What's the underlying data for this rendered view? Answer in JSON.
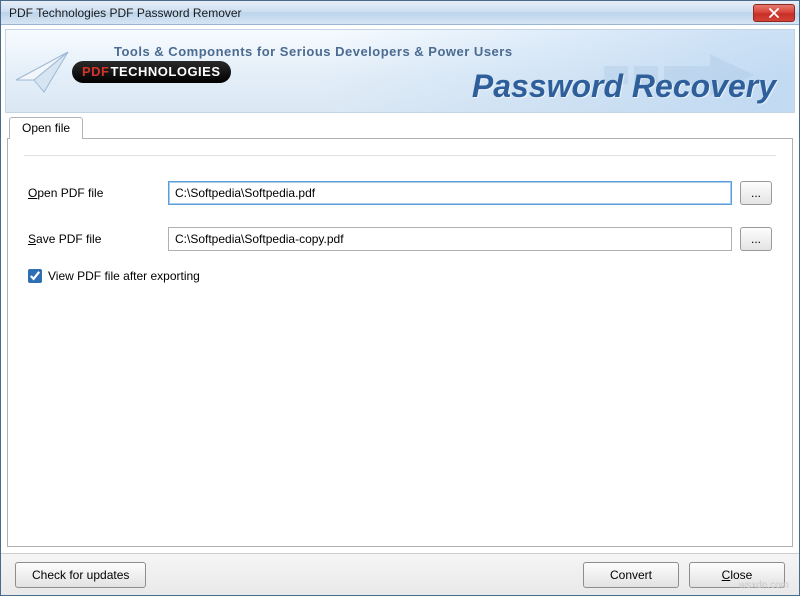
{
  "window": {
    "title": "PDF Technologies PDF Password Remover"
  },
  "banner": {
    "tagline": "Tools & Components for Serious Developers & Power Users",
    "product_title": "Password Recovery",
    "logo_pdf": "PDF",
    "logo_tech": "TECHNOLOGIES"
  },
  "tabs": {
    "open_file": "Open file"
  },
  "form": {
    "open_label_u": "O",
    "open_label_rest": "pen PDF file",
    "open_value": "C:\\Softpedia\\Softpedia.pdf",
    "save_label_u": "S",
    "save_label_rest": "ave PDF file",
    "save_value": "C:\\Softpedia\\Softpedia-copy.pdf",
    "browse_label": "...",
    "view_after_u": "V",
    "view_after_rest": "iew PDF file after exporting"
  },
  "buttons": {
    "check_updates": "Check for updates",
    "convert": "Convert",
    "close_u": "C",
    "close_rest": "lose"
  },
  "watermark": "wsxdn.com"
}
